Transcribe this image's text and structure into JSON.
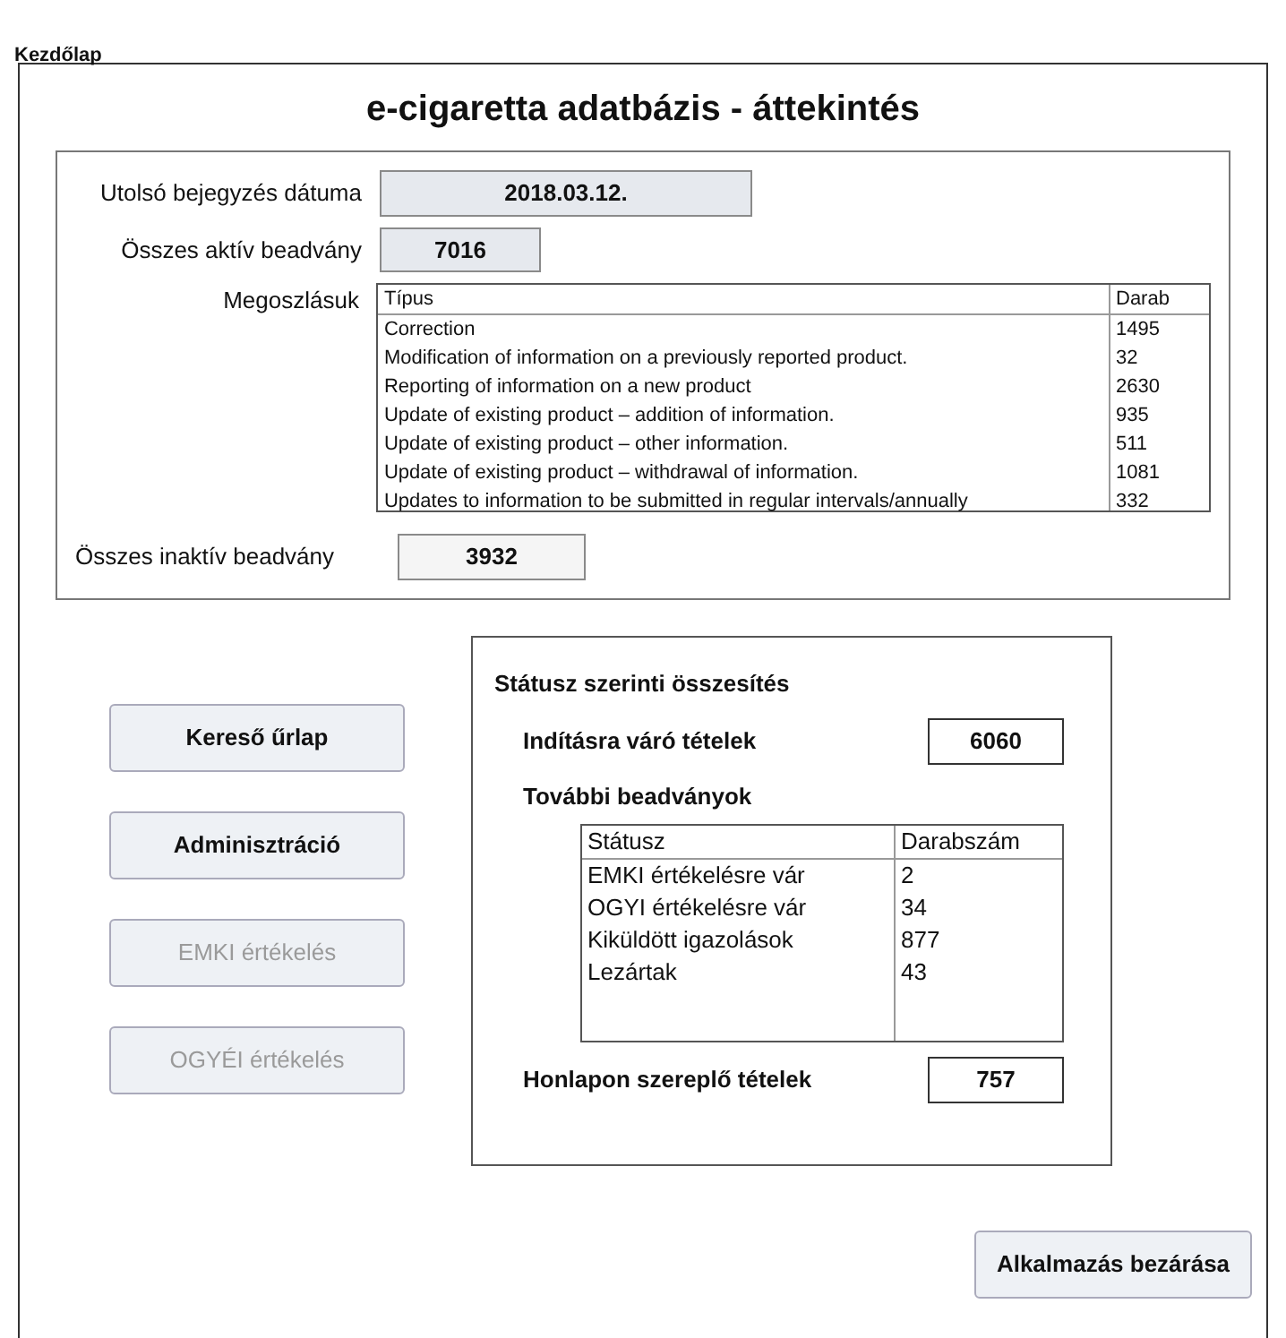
{
  "tab": {
    "label": "Kezdőlap"
  },
  "title": "e-cigaretta adatbázis - áttekintés",
  "overview": {
    "last_entry": {
      "label": "Utolsó bejegyzés dátuma",
      "value": "2018.03.12."
    },
    "active_total": {
      "label": "Összes aktív beadvány",
      "value": "7016"
    },
    "distribution": {
      "label": "Megoszlásuk",
      "columns": [
        "Típus",
        "Darab"
      ],
      "rows": [
        {
          "type": "Correction",
          "count": "1495"
        },
        {
          "type": "Modification of information on a previously reported product.",
          "count": "32"
        },
        {
          "type": "Reporting of information on a new product",
          "count": "2630"
        },
        {
          "type": "Update of existing product – addition of information.",
          "count": "935"
        },
        {
          "type": "Update of existing product – other information.",
          "count": "511"
        },
        {
          "type": "Update of existing product – withdrawal of information.",
          "count": "1081"
        },
        {
          "type": "Updates to information to be submitted in regular intervals/annually",
          "count": "332"
        }
      ]
    },
    "inactive_total": {
      "label": "Összes inaktív beadvány",
      "value": "3932"
    }
  },
  "nav_buttons": [
    {
      "label": "Kereső űrlap",
      "disabled": false
    },
    {
      "label": "Adminisztráció",
      "disabled": false
    },
    {
      "label": "EMKI értékelés",
      "disabled": true
    },
    {
      "label": "OGYÉI értékelés",
      "disabled": true
    }
  ],
  "status_summary": {
    "title": "Státusz szerinti összesítés",
    "pending": {
      "label": "Indításra váró tételek",
      "value": "6060"
    },
    "further_label": "További beadványok",
    "columns": [
      "Státusz",
      "Darabszám"
    ],
    "rows": [
      {
        "status": "EMKI értékelésre vár",
        "count": "2"
      },
      {
        "status": "OGYI értékelésre vár",
        "count": "34"
      },
      {
        "status": "Kiküldött igazolások",
        "count": "877"
      },
      {
        "status": "Lezártak",
        "count": "43"
      }
    ],
    "on_website": {
      "label": "Honlapon szereplő tételek",
      "value": "757"
    }
  },
  "close_button": "Alkalmazás bezárása"
}
